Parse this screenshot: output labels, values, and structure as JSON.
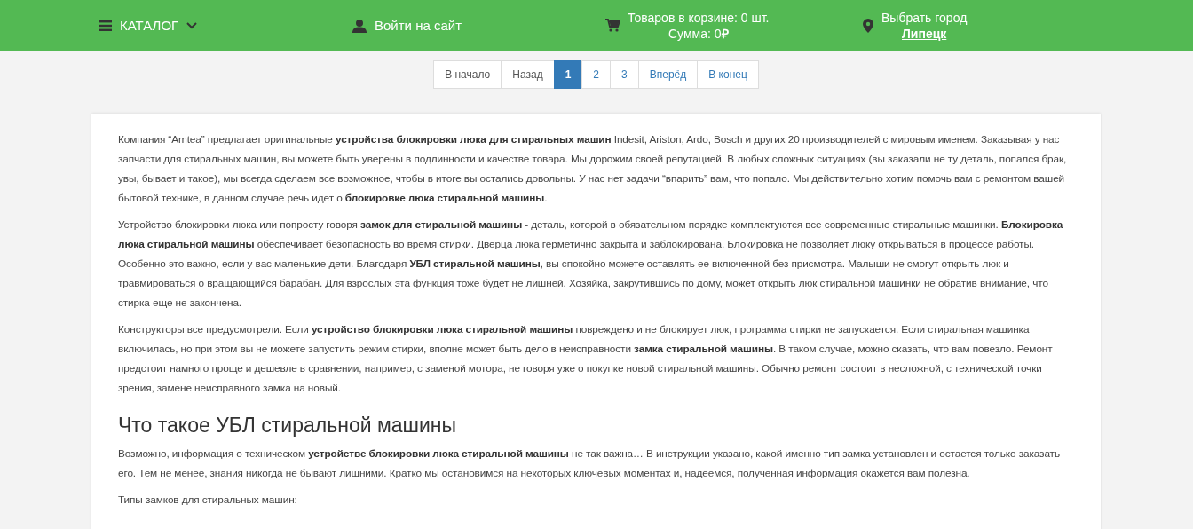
{
  "header": {
    "catalog": "КАТАЛОГ",
    "login": "Войти на сайт",
    "cart_line": "Товаров в корзине: 0 шт.",
    "cart_sum": "Сумма: 0",
    "currency": "₽",
    "city_label": "Выбрать город",
    "city": "Липецк"
  },
  "pagination": [
    {
      "label": "В начало",
      "selected": false
    },
    {
      "label": "Назад",
      "selected": false
    },
    {
      "label": "1",
      "selected": true
    },
    {
      "label": "2",
      "selected": false
    },
    {
      "label": "3",
      "selected": false
    },
    {
      "label": "Вперёд",
      "selected": false
    },
    {
      "label": "В конец",
      "selected": false
    }
  ],
  "article": [
    {
      "kind": "paragraph",
      "text": "Компания “Amtea” предлагает оригинальные **устройства блокировки люка для стиральных машин** Indesit, Ariston, Ardo, Bosch и других 20 производителей с мировым именем. Заказывая у нас запчасти для стиральных машин, вы можете быть уверены в подлинности и качестве товара. Мы дорожим своей репутацией. В любых сложных ситуациях (вы заказали не ту деталь, попался брак, увы, бывает и такое), мы всегда сделаем все возможное, чтобы в итоге вы остались довольны. У нас нет задачи “впарить” вам, что попало. Мы действительно хотим помочь вам с ремонтом вашей бытовой технике, в данном случае речь идет о **блокировке люка стиральной машины**."
    },
    {
      "kind": "paragraph",
      "text": "Устройство блокировки люка или попросту говоря **замок для стиральной машины** - деталь, которой в обязательном порядке комплектуются все современные стиральные машинки. **Блокировка люка стиральной машины** обеспечивает безопасность во время стирки. Дверца люка герметично закрыта и заблокирована. Блокировка не позволяет люку открываться в процессе работы. Особенно это важно, если у вас маленькие дети. Благодаря **УБЛ стиральной машины**, вы спокойно можете оставлять ее включенной без присмотра. Малыши не смогут открыть люк и травмироваться о вращающийся барабан. Для взрослых эта функция тоже будет не лишней. Хозяйка, закрутившись по дому, может открыть люк стиральной машинки не обратив внимание, что стирка еще не закончена."
    },
    {
      "kind": "paragraph",
      "text": "Конструкторы все предусмотрели. Если **устройство блокировки люка стиральной машины** повреждено и не блокирует люк, программа стирки не запускается. Если стиральная машинка включилась, но при этом вы не можете запустить режим стирки, вполне может быть дело в неисправности **замка стиральной машины**. В таком случае, можно сказать, что вам повезло. Ремонт предстоит намного проще и дешевле в сравнении, например, с заменой мотора, не говоря уже о покупке новой стиральной машины. Обычно ремонт состоит в несложной, с технической точки зрения, замене неисправного замка на новый."
    },
    {
      "kind": "heading",
      "text": "Что такое УБЛ стиральной машины"
    },
    {
      "kind": "paragraph",
      "text": "Возможно, информация о техническом **устройстве блокировки люка стиральной машины** не так важна…  В инструкции указано, какой именно тип замка установлен и остается только заказать его. Тем не менее, знания никогда не бывают лишними. Кратко мы остановимся на некоторых ключевых моментах и, надеемся, полученная информация окажется вам полезна."
    },
    {
      "kind": "paragraph",
      "text": "Типы замков для стиральных машин:"
    }
  ]
}
